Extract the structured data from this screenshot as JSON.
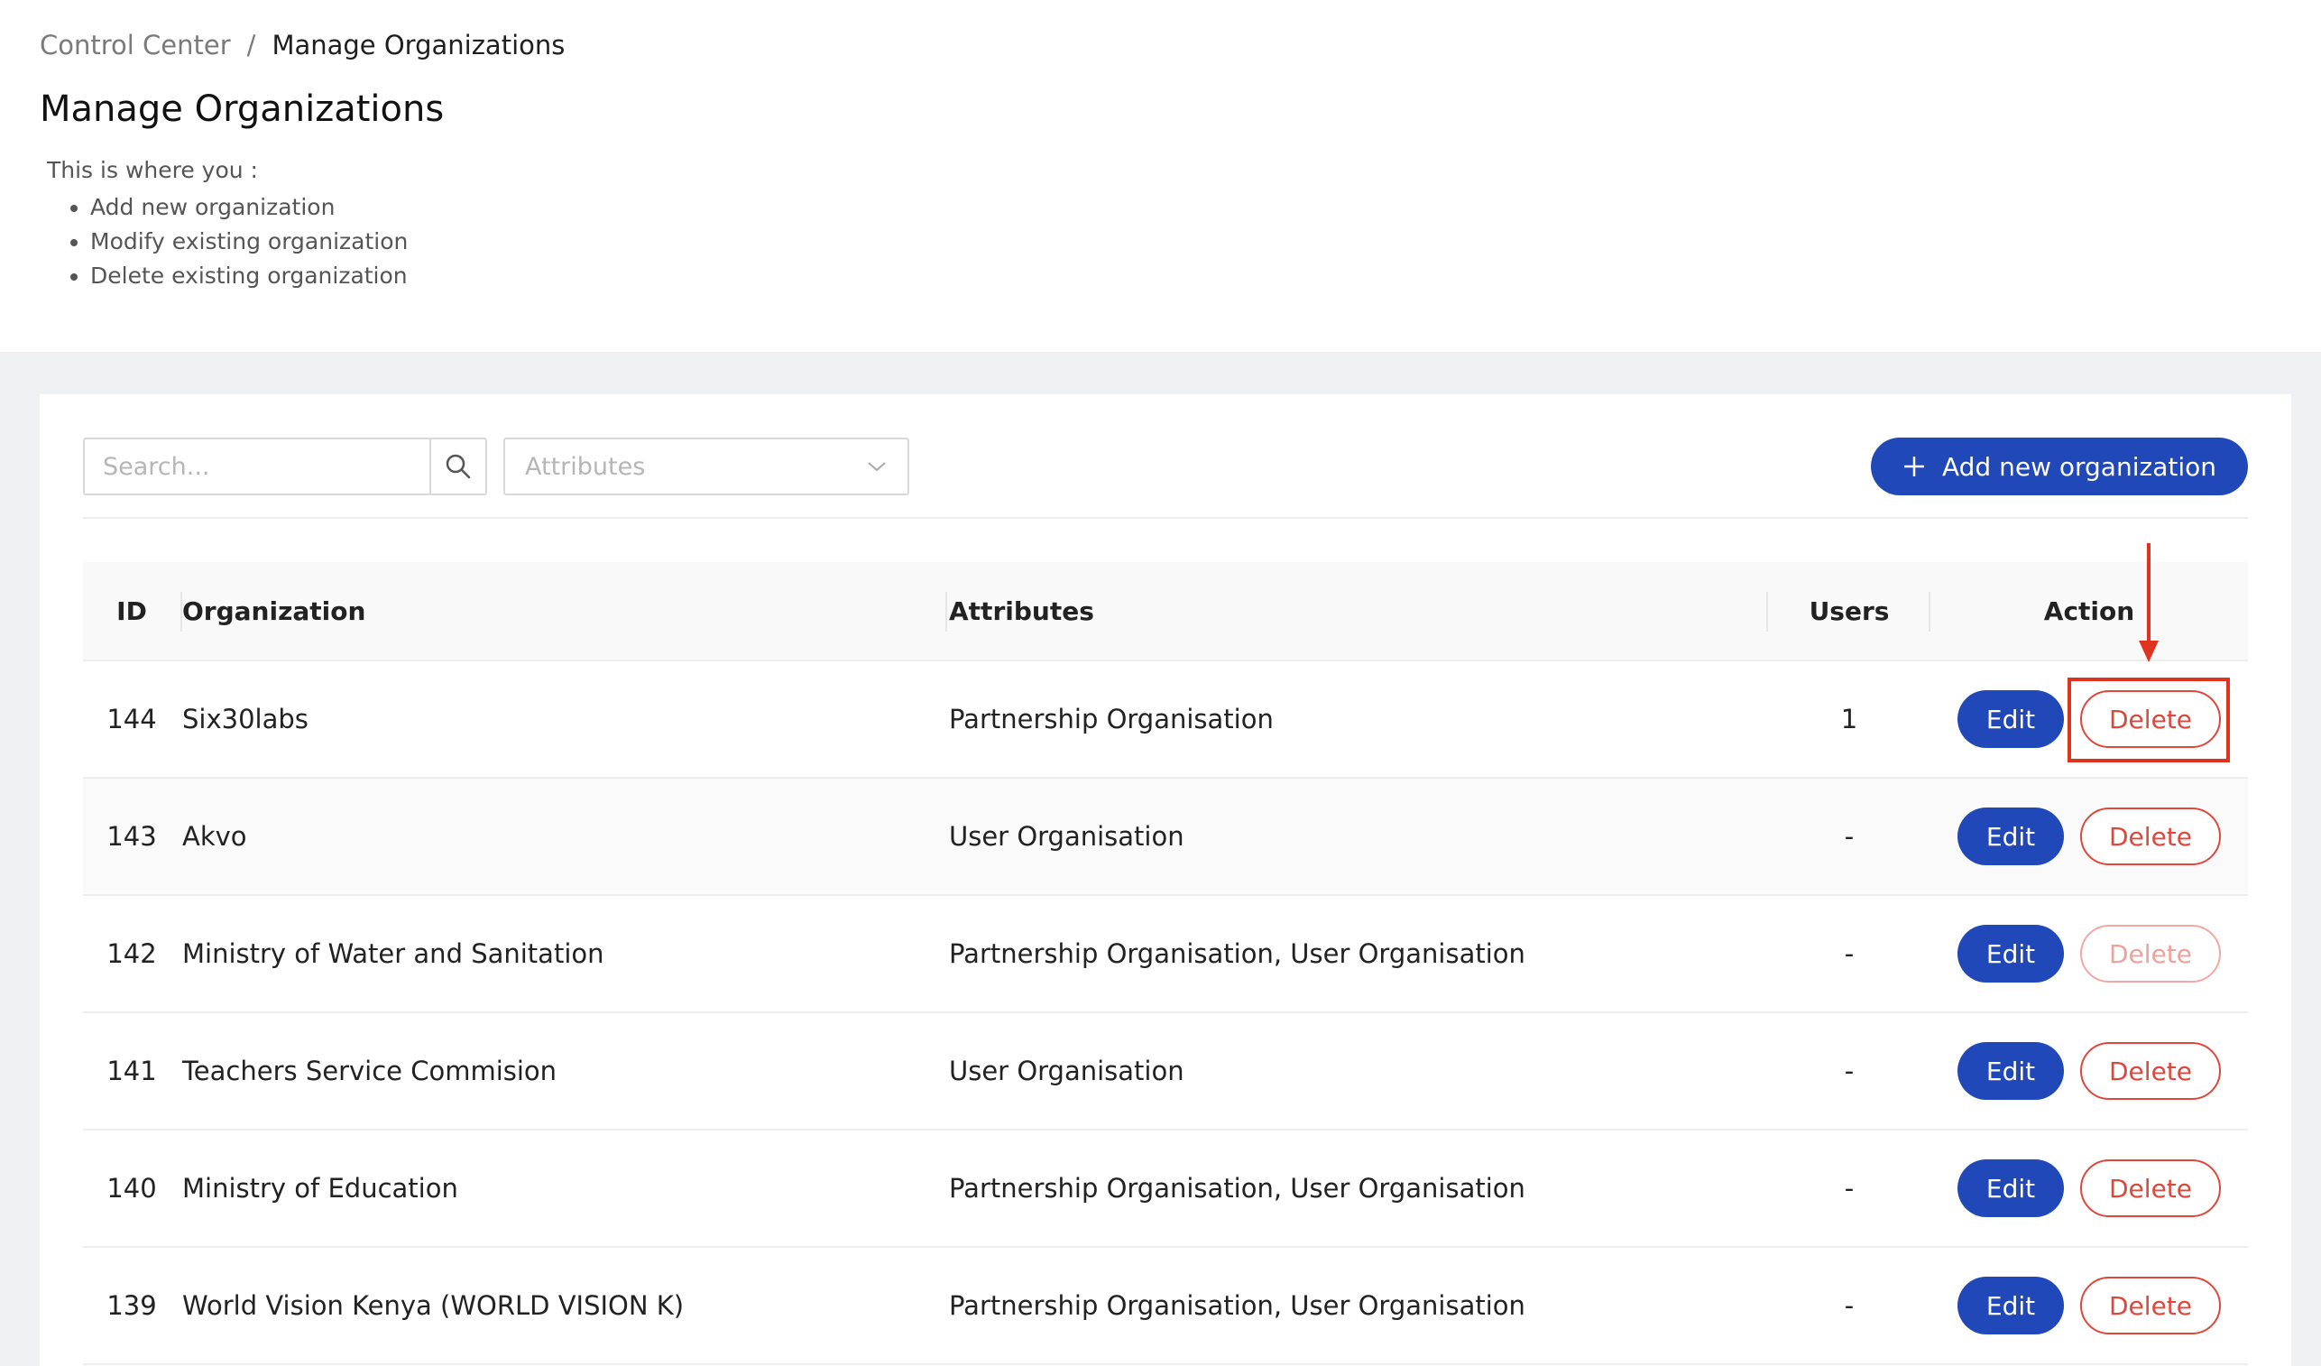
{
  "breadcrumb": {
    "parent": "Control Center",
    "separator": "/",
    "current": "Manage Organizations"
  },
  "page_title": "Manage Organizations",
  "intro": {
    "lead": "This is where you :",
    "items": [
      "Add new organization",
      "Modify existing organization",
      "Delete existing organization"
    ]
  },
  "toolbar": {
    "search_placeholder": "Search...",
    "attributes_placeholder": "Attributes",
    "add_label": "Add new organization"
  },
  "table": {
    "headers": {
      "id": "ID",
      "organization": "Organization",
      "attributes": "Attributes",
      "users": "Users",
      "action": "Action"
    },
    "edit_label": "Edit",
    "delete_label": "Delete",
    "rows": [
      {
        "id": "144",
        "organization": "Six30labs",
        "attributes": "Partnership Organisation",
        "users": "1"
      },
      {
        "id": "143",
        "organization": "Akvo",
        "attributes": "User Organisation",
        "users": "-"
      },
      {
        "id": "142",
        "organization": "Ministry of Water and Sanitation",
        "attributes": "Partnership Organisation, User Organisation",
        "users": "-"
      },
      {
        "id": "141",
        "organization": "Teachers Service Commision",
        "attributes": "User Organisation",
        "users": "-"
      },
      {
        "id": "140",
        "organization": "Ministry of Education",
        "attributes": "Partnership Organisation, User Organisation",
        "users": "-"
      },
      {
        "id": "139",
        "organization": "World Vision Kenya (WORLD VISION K)",
        "attributes": "Partnership Organisation, User Organisation",
        "users": "-"
      }
    ]
  },
  "colors": {
    "primary": "#2148b8",
    "danger": "#e0473b",
    "annotation": "#e0331f"
  },
  "icons": {
    "search": "search-icon",
    "dropdown": "chevron-down-icon",
    "add": "plus-icon",
    "annotation": "arrow-down-icon"
  }
}
